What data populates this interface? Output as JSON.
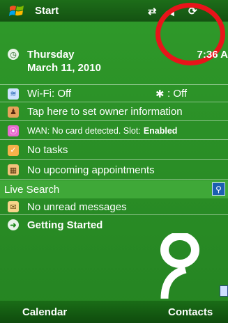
{
  "topbar": {
    "start_label": "Start",
    "icons": [
      "connectivity-icon",
      "speaker-icon",
      "sync-icon"
    ]
  },
  "today": {
    "day": "Thursday",
    "date": "March 11, 2010",
    "time": "7:36 A"
  },
  "items": {
    "wifi": "Wi-Fi: Off",
    "bluetooth": ": Off",
    "owner": "Tap here to set owner information",
    "wan_text": "WAN: No card detected.  Slot:",
    "wan_slot": "Enabled",
    "tasks": "No tasks",
    "appointments": "No upcoming appointments",
    "search": "Live Search",
    "messages": "No unread messages",
    "getting_started": "Getting Started"
  },
  "softkeys": {
    "left": "Calendar",
    "right": "Contacts"
  },
  "colors": {
    "background": "#2b9027",
    "bar": "#145212",
    "highlight_circle": "#e8141a"
  }
}
